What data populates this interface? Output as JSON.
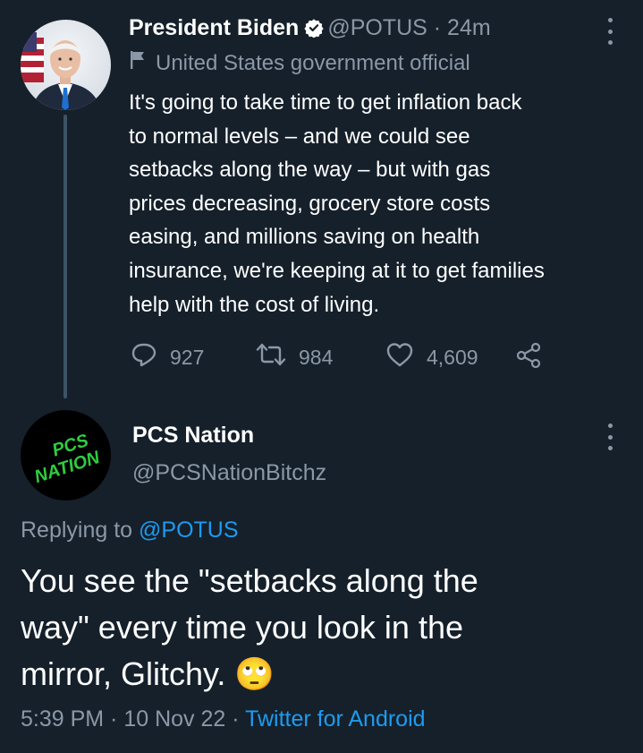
{
  "original_tweet": {
    "author_name": "President Biden",
    "handle": "@POTUS",
    "time": "24m",
    "label": "United States government official",
    "text_lines": [
      "It's going to take time to get inflation back",
      "to normal levels – and we could see",
      "setbacks along the way – but with gas",
      "prices decreasing, grocery store costs",
      "easing, and millions saving on health",
      "insurance, we're keeping at it to get families",
      "help with the cost of living."
    ],
    "replies": "927",
    "retweets": "984",
    "likes": "4,609",
    "icons": [
      "verified-badge-icon",
      "flag-icon",
      "reply-icon",
      "retweet-icon",
      "like-icon",
      "share-icon",
      "more-options-icon"
    ]
  },
  "reply_tweet": {
    "author_name": "PCS Nation",
    "handle": "@PCSNationBitchz",
    "avatar_text_1": "PCS",
    "avatar_text_2": "NATION",
    "replying_prefix": "Replying to",
    "replying_to": "@POTUS",
    "text_lines": [
      "You see the \"setbacks along the",
      "way\" every time you look in the",
      "mirror, Glitchy."
    ],
    "emoji": "🙄",
    "time": "5:39 PM",
    "date": "10 Nov 22",
    "source": "Twitter for Android"
  },
  "colors": {
    "background": "#15202b",
    "muted": "#8b98a5",
    "link": "#1d9bf0",
    "thread_line": "#3d5466",
    "avatar_text": "#2ecc40"
  }
}
